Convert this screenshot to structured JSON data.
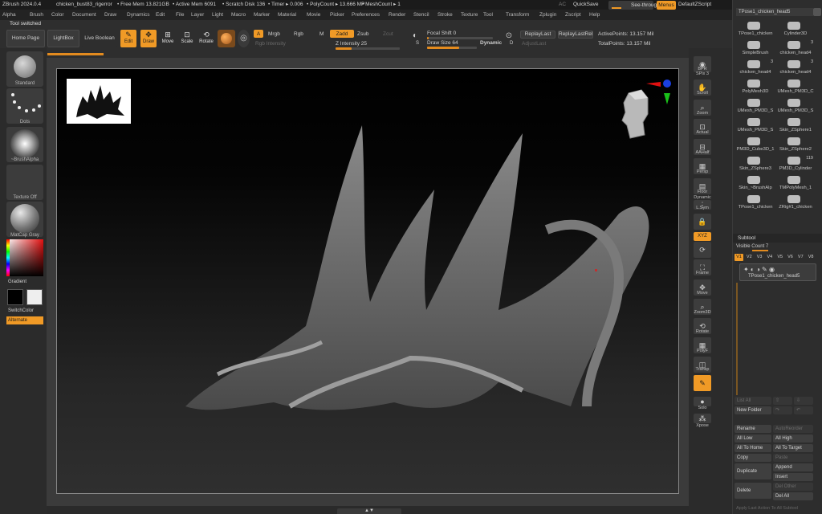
{
  "titlebar": {
    "app": "ZBrush 2024.0.4",
    "document": "chicken_bust83_rigerror",
    "free_mem": "• Free Mem 13.821GB",
    "active_mem": "• Active Mem 6091",
    "scratch_disk": "• Scratch Disk 136",
    "timer": "• Timer ▸ 0.006",
    "polycount": "• PolyCount ▸ 13.666 MP",
    "meshcount": "• MeshCount ▸ 1",
    "ac": "AC",
    "quicksave": "QuickSave",
    "see_through": "See-through  0",
    "menus": "Menus",
    "zscript": "DefaultZScript"
  },
  "menubar": [
    "Alpha",
    "Brush",
    "Color",
    "Document",
    "Draw",
    "Dynamics",
    "Edit",
    "File",
    "Layer",
    "Light",
    "Macro",
    "Marker",
    "Material",
    "Movie",
    "Picker",
    "Preferences",
    "Render",
    "Stencil",
    "Stroke",
    "Texture",
    "Tool",
    "Transform",
    "Zplugin",
    "Zscript",
    "Help"
  ],
  "status_note": "Tool switched",
  "toolbar": {
    "home_page": "Home Page",
    "lightbox": "LightBox",
    "live_boolean": "Live Boolean",
    "edit": "Edit",
    "draw": "Draw",
    "move": "Move",
    "scale": "Scale",
    "rotate": "Rotate",
    "a_btn": "A",
    "mrgb": "Mrgb",
    "rgb": "Rgb",
    "m": "M",
    "zadd": "Zadd",
    "zsub": "Zsub",
    "zcut": "Zcut",
    "rgb_intensity": "Rgb Intensity",
    "z_intensity": "Z Intensity 25",
    "focal_shift": "Focal Shift 0",
    "draw_size": "Draw Size 64",
    "dynamic": "Dynamic",
    "replay_last": "ReplayLast",
    "replay_last_rel": "ReplayLastRel",
    "adjust_last": "AdjustLast",
    "active_points": "ActivePoints: 13.157 Mil",
    "total_points": "TotalPoints: 13.157 Mil",
    "s_key": "S",
    "d_key": "D",
    "z_intensity_value": 0.25,
    "focal_shift_value": 0,
    "draw_size_value": 0.64
  },
  "left_shelf": {
    "brush": "Standard",
    "stroke": "Dots",
    "alpha": "~BrushAlpha",
    "texture": "Texture Off",
    "material": "MatCap Gray",
    "gradient": "Gradient",
    "switch_color": "SwitchColor",
    "alternate": "Alternate"
  },
  "right_shelf": {
    "bpr": "BPR",
    "spix": "SPix 3",
    "scroll": "Scroll",
    "zoom": "Zoom",
    "actual": "Actual",
    "aahalf": "AAHalf",
    "persp": "Persp",
    "floor": "Floor",
    "lsym": "L.Sym",
    "xyz": "XYZ",
    "frame": "Frame",
    "move": "Move",
    "zoom3d": "Zoom3D",
    "rotate": "Rotate",
    "polyf": "PolyF",
    "transp": "Transp",
    "dynamic": "Dynamic",
    "solo": "Solo",
    "xpose": "Xpose"
  },
  "tool_panel": {
    "current_tool": "TPose1_chicken_head5",
    "tools": [
      {
        "name": "TPose1_chicken",
        "count": ""
      },
      {
        "name": "Cylinder3D",
        "count": ""
      },
      {
        "name": "SimpleBrush",
        "count": ""
      },
      {
        "name": "chicken_head4",
        "count": "3"
      },
      {
        "name": "chicken_head4",
        "count": "3"
      },
      {
        "name": "chicken_head4",
        "count": "3"
      },
      {
        "name": "PolyMesh3D",
        "count": ""
      },
      {
        "name": "UMesh_PM3D_C",
        "count": ""
      },
      {
        "name": "UMesh_PM3D_S",
        "count": ""
      },
      {
        "name": "UMesh_PM3D_S",
        "count": ""
      },
      {
        "name": "UMesh_PM3D_S",
        "count": ""
      },
      {
        "name": "Skin_ZSphere1",
        "count": ""
      },
      {
        "name": "PM3D_Cube3D_1",
        "count": ""
      },
      {
        "name": "Skin_ZSphere2",
        "count": ""
      },
      {
        "name": "Skin_ZSphere3",
        "count": ""
      },
      {
        "name": "PM3D_Cylinder",
        "count": "119"
      },
      {
        "name": "Skin_~BrushAlp",
        "count": ""
      },
      {
        "name": "TMPolyMesh_1",
        "count": ""
      },
      {
        "name": "TPose1_chicken",
        "count": ""
      },
      {
        "name": "ZRig#1_chicken",
        "count": ""
      }
    ],
    "subtool_header": "Subtool",
    "visible_count": "Visible Count 7",
    "version_tabs": [
      "V1",
      "V2",
      "V3",
      "V4",
      "V5",
      "V6",
      "V7",
      "V8"
    ],
    "subtool_item": "TPose1_chicken_head5",
    "list_all": "List All",
    "new_folder": "New Folder",
    "rename": "Rename",
    "auto_reorder": "AutoReorder",
    "all_low": "All Low",
    "all_high": "All High",
    "all_to_home": "All To Home",
    "all_to_target": "All To Target",
    "copy": "Copy",
    "paste": "Paste",
    "duplicate": "Duplicate",
    "append": "Append",
    "insert": "Insert",
    "delete": "Delete",
    "del_other": "Del Other",
    "del_all": "Del All",
    "footer_hint": "Apply Last Action To All Subtool"
  },
  "colors": {
    "accent": "#f09a26",
    "panel": "#2d2d2d",
    "viewport_top": "#000000",
    "viewport_bottom": "#2f2f2f"
  }
}
